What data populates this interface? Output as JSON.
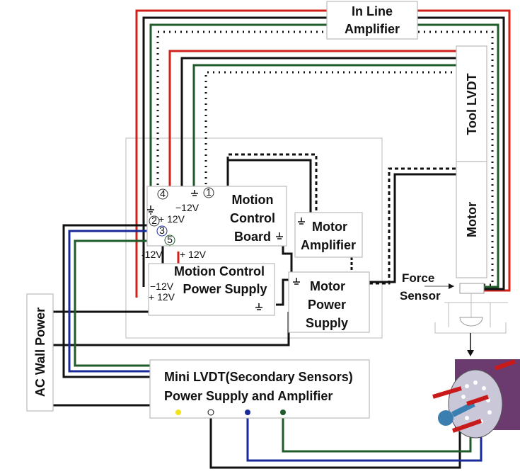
{
  "blocks": {
    "inline_amplifier": [
      "In Line",
      "Amplifier"
    ],
    "tool_lvdt": "Tool LVDT",
    "motor": "Motor",
    "motion_control_board": [
      "Motion",
      "Control",
      "Board"
    ],
    "motor_amplifier": [
      "Motor",
      "Amplifier"
    ],
    "motion_control_power_supply": [
      "Motion Control",
      "Power Supply"
    ],
    "motor_power_supply": [
      "Motor",
      "Power",
      "Supply"
    ],
    "ac_wall_power": "AC Wall Power",
    "mini_lvdt": [
      "Mini LVDT(Secondary Sensors)",
      "Power Supply and Amplifier"
    ],
    "force_sensor": [
      "Force",
      "Sensor"
    ]
  },
  "voltage_labels": {
    "board_minus12": "−12V",
    "board_plus12": "+ 12V",
    "supply_top_minus12": "-12V",
    "supply_top_plus12": "+ 12V",
    "supply_left_minus12": "−12V",
    "supply_left_plus12": "+ 12V"
  },
  "pin_numbers": [
    "1",
    "2",
    "3",
    "4",
    "5"
  ],
  "colors": {
    "red": "#d0201a",
    "black": "#111111",
    "green": "#1f5a2a",
    "blue": "#1a2a9a",
    "yellow": "#f2e21a"
  }
}
